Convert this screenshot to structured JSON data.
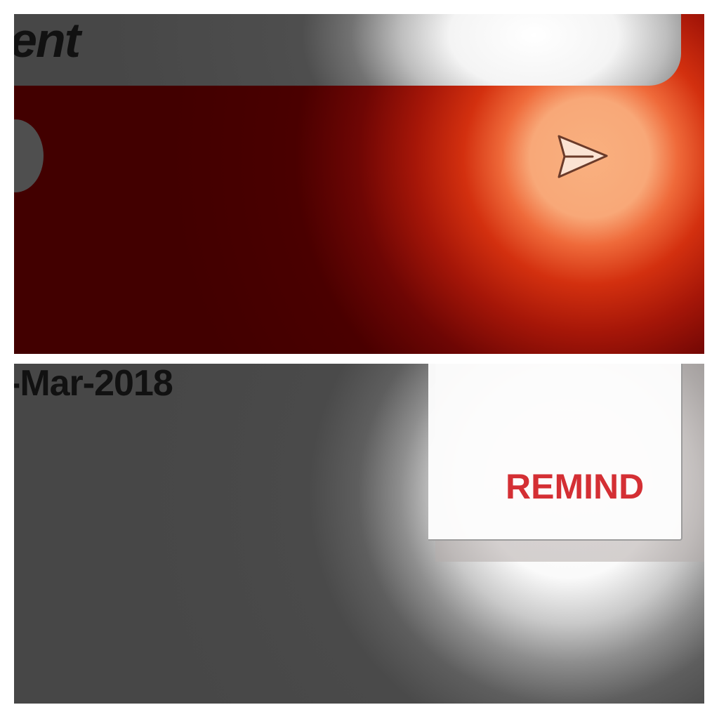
{
  "top_panel": {
    "header_title": "ent",
    "send_icon": "send-paper-plane-icon"
  },
  "bottom_panel": {
    "date": "-Mar-2018",
    "remind_label": "REMIND"
  },
  "colors": {
    "top_background": "#420000",
    "glow_orange": "#f9b07f",
    "header_gray": "#474747",
    "bottom_background": "#474747",
    "remind_text": "#d42f34"
  }
}
